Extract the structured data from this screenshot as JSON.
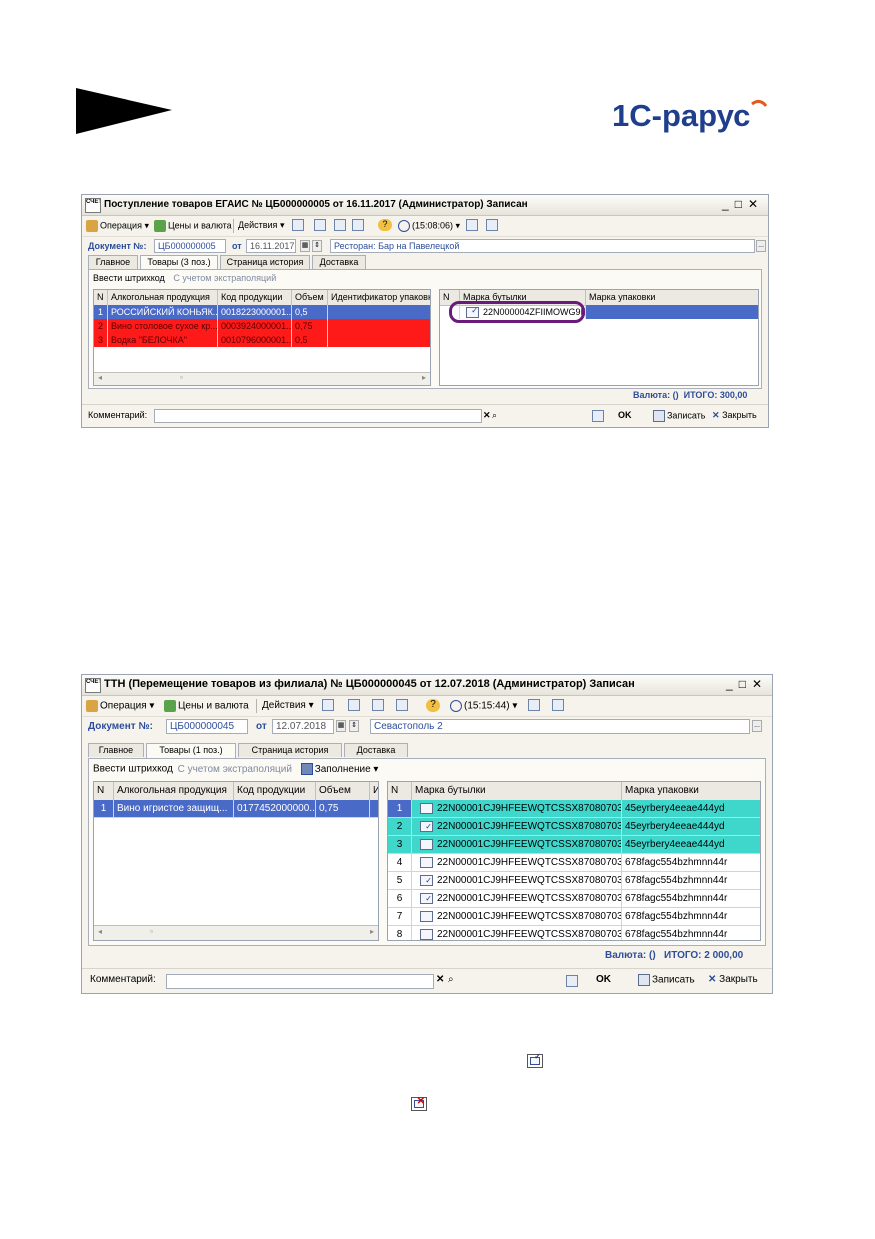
{
  "logo": {
    "text": "1С-рарус"
  },
  "window1": {
    "title": "Поступление товаров ЕГАИС № ЦБ000000005 от 16.11.2017 (Администратор) Записан",
    "toolbar": {
      "operation": "Операция",
      "prices": "Цены и валюта",
      "actions": "Действия",
      "time": "(15:08:06)"
    },
    "doc_label": "Документ №:",
    "doc_number": "ЦБ000000005",
    "date_label": "от",
    "date": "16.11.2017",
    "org": "Ресторан: Бар на Павелецкой",
    "tabs": [
      "Главное",
      "Товары (3 поз.)",
      "Страница история",
      "Доставка"
    ],
    "enter_barcode": "Ввести штрихкод",
    "with_extrapolation": "С учетом экстраполяций",
    "left_headers": [
      "N",
      "Алкогольная продукция",
      "Код продукции",
      "Объем",
      "Идентификатор упаковки"
    ],
    "left_rows": [
      {
        "n": "1",
        "name": "РОССИЙСКИЙ КОНЬЯК...",
        "code": "0018223000001...",
        "vol": "0,5",
        "pack": ""
      },
      {
        "n": "2",
        "name": "Вино столовое сухое кр...",
        "code": "0003924000001...",
        "vol": "0,75",
        "pack": ""
      },
      {
        "n": "3",
        "name": "Водка \"БЕЛОЧКА\"",
        "code": "0010796000001...",
        "vol": "0,5",
        "pack": ""
      }
    ],
    "right_headers": [
      "N",
      "Марка бутылки",
      "Марка упаковки"
    ],
    "right_rows": [
      {
        "n": "",
        "mark": "22N000004ZFIIMOWG9I0...",
        "pack": ""
      }
    ],
    "currency_label": "Валюта:",
    "currency": "()",
    "total_label": "ИТОГО:",
    "total": "300,00",
    "comment_label": "Комментарий:",
    "ok": "OK",
    "save": "Записать",
    "close": "Закрыть"
  },
  "window2": {
    "title": "ТТН (Перемещение товаров из филиала) № ЦБ000000045 от 12.07.2018 (Администратор) Записан",
    "toolbar": {
      "operation": "Операция",
      "prices": "Цены и валюта",
      "actions": "Действия",
      "time": "(15:15:44)"
    },
    "doc_label": "Документ №:",
    "doc_number": "ЦБ000000045",
    "date_label": "от",
    "date": "12.07.2018",
    "org": "Севастополь 2",
    "tabs": [
      "Главное",
      "Товары (1 поз.)",
      "Страница история",
      "Доставка"
    ],
    "enter_barcode": "Ввести штрихкод",
    "with_extrapolation": "С учетом экстраполяций",
    "fill": "Заполнение",
    "left_headers": [
      "N",
      "Алкогольная продукция",
      "Код продукции",
      "Объем",
      "И,"
    ],
    "left_rows": [
      {
        "n": "1",
        "name": "Вино игристое защищ...",
        "code": "0177452000000...",
        "vol": "0,75",
        "id": ""
      }
    ],
    "right_headers": [
      "N",
      "Марка бутылки",
      "Марка упаковки"
    ],
    "right_rows": [
      {
        "n": "1",
        "mark": "22N00001CJ9HFEEWQTCSSX87080703...",
        "pack": "45eyrbery4eeae444yd"
      },
      {
        "n": "2",
        "mark": "22N00001CJ9HFEEWQTCSSX87080703...",
        "pack": "45eyrbery4eeae444yd"
      },
      {
        "n": "3",
        "mark": "22N00001CJ9HFEEWQTCSSX87080703",
        "pack": "45eyrbery4eeae444yd"
      },
      {
        "n": "4",
        "mark": "22N00001CJ9HFEEWQTCSSX87080703...",
        "pack": "678fagc554bzhmnn44r"
      },
      {
        "n": "5",
        "mark": "22N00001CJ9HFEEWQTCSSX87080703...",
        "pack": "678fagc554bzhmnn44r"
      },
      {
        "n": "6",
        "mark": "22N00001CJ9HFEEWQTCSSX87080703...",
        "pack": "678fagc554bzhmnn44r"
      },
      {
        "n": "7",
        "mark": "22N00001CJ9HFEEWQTCSSX87080703...",
        "pack": "678fagc554bzhmnn44r"
      },
      {
        "n": "8",
        "mark": "22N00001CJ9HFEEWQTCSSX87080703...",
        "pack": "678fagc554bzhmnn44r"
      }
    ],
    "currency_label": "Валюта:",
    "currency": "()",
    "total_label": "ИТОГО:",
    "total": "2 000,00",
    "comment_label": "Комментарий:",
    "ok": "OK",
    "save": "Записать",
    "close": "Закрыть"
  },
  "colors": {
    "selected": "#4a6ac8",
    "error_row": "#ff1a1a",
    "scanned_row": "#3fd6cc",
    "accent": "#2e4d9b",
    "circle": "#6a1a7a"
  }
}
